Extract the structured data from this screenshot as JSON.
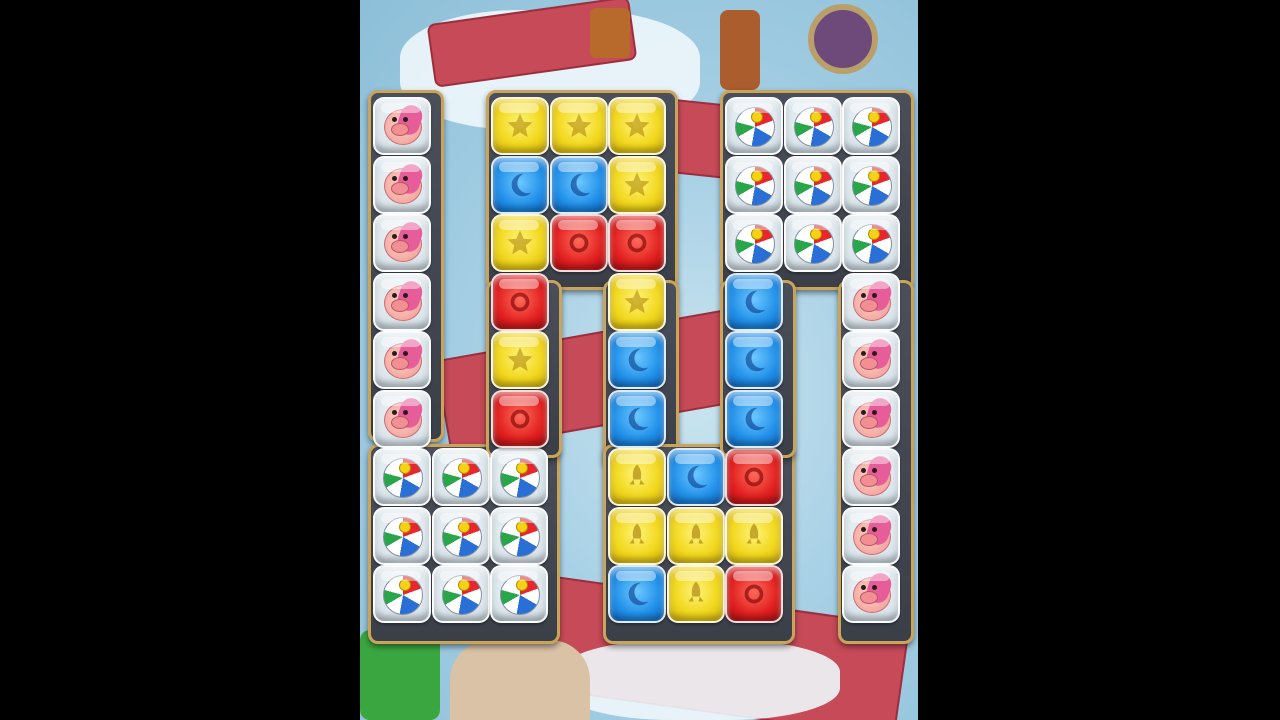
{
  "screen": {
    "background": "#000000",
    "game_area_color": "#a9d1e6"
  },
  "tile_types": {
    "Y": {
      "name": "yellow-block",
      "color": "#f2d81e"
    },
    "B": {
      "name": "blue-block",
      "color": "#1f8ee8"
    },
    "R": {
      "name": "red-block",
      "color": "#e01e1e"
    },
    "P": {
      "name": "piggy-bank",
      "color": "#f2a39c"
    },
    "BB": {
      "name": "beach-ball",
      "color": "#ffffff"
    }
  },
  "boards": [
    {
      "name": "board-left",
      "tiles": [
        {
          "row": 0,
          "col": 0,
          "type": "P"
        },
        {
          "row": 1,
          "col": 0,
          "type": "P"
        },
        {
          "row": 2,
          "col": 0,
          "type": "P"
        },
        {
          "row": 3,
          "col": 0,
          "type": "P"
        },
        {
          "row": 4,
          "col": 0,
          "type": "P"
        },
        {
          "row": 5,
          "col": 0,
          "type": "P"
        },
        {
          "row": 6,
          "col": 0,
          "type": "BB"
        },
        {
          "row": 6,
          "col": 1,
          "type": "BB"
        },
        {
          "row": 6,
          "col": 2,
          "type": "BB"
        },
        {
          "row": 7,
          "col": 0,
          "type": "BB"
        },
        {
          "row": 7,
          "col": 1,
          "type": "BB"
        },
        {
          "row": 7,
          "col": 2,
          "type": "BB"
        },
        {
          "row": 8,
          "col": 0,
          "type": "BB"
        },
        {
          "row": 8,
          "col": 1,
          "type": "BB"
        },
        {
          "row": 8,
          "col": 2,
          "type": "BB"
        }
      ]
    },
    {
      "name": "board-middle",
      "tiles": [
        {
          "row": 0,
          "col": 0,
          "type": "Y",
          "icon": "star"
        },
        {
          "row": 0,
          "col": 1,
          "type": "Y",
          "icon": "star"
        },
        {
          "row": 0,
          "col": 2,
          "type": "Y",
          "icon": "star"
        },
        {
          "row": 1,
          "col": 0,
          "type": "B",
          "icon": "moon"
        },
        {
          "row": 1,
          "col": 1,
          "type": "B",
          "icon": "moon"
        },
        {
          "row": 1,
          "col": 2,
          "type": "Y",
          "icon": "star"
        },
        {
          "row": 2,
          "col": 0,
          "type": "Y",
          "icon": "star"
        },
        {
          "row": 2,
          "col": 1,
          "type": "R",
          "icon": "ring"
        },
        {
          "row": 2,
          "col": 2,
          "type": "R",
          "icon": "ring"
        },
        {
          "row": 3,
          "col": 0,
          "type": "R",
          "icon": "ring"
        },
        {
          "row": 3,
          "col": 2,
          "type": "Y",
          "icon": "star"
        },
        {
          "row": 4,
          "col": 0,
          "type": "Y",
          "icon": "star"
        },
        {
          "row": 4,
          "col": 2,
          "type": "B",
          "icon": "moon"
        },
        {
          "row": 5,
          "col": 0,
          "type": "R",
          "icon": "ring"
        },
        {
          "row": 5,
          "col": 2,
          "type": "B",
          "icon": "moon"
        },
        {
          "row": 6,
          "col": 2,
          "type": "Y",
          "icon": "rocket"
        },
        {
          "row": 6,
          "col": 3,
          "type": "B",
          "icon": "moon"
        },
        {
          "row": 6,
          "col": 4,
          "type": "R",
          "icon": "ring"
        },
        {
          "row": 7,
          "col": 2,
          "type": "Y",
          "icon": "rocket"
        },
        {
          "row": 7,
          "col": 3,
          "type": "Y",
          "icon": "rocket"
        },
        {
          "row": 7,
          "col": 4,
          "type": "Y",
          "icon": "rocket"
        },
        {
          "row": 8,
          "col": 2,
          "type": "B",
          "icon": "moon"
        },
        {
          "row": 8,
          "col": 3,
          "type": "Y",
          "icon": "rocket"
        },
        {
          "row": 8,
          "col": 4,
          "type": "R",
          "icon": "ring"
        }
      ]
    },
    {
      "name": "board-right",
      "tiles": [
        {
          "row": 0,
          "col": 0,
          "type": "BB"
        },
        {
          "row": 0,
          "col": 1,
          "type": "BB"
        },
        {
          "row": 0,
          "col": 2,
          "type": "BB"
        },
        {
          "row": 1,
          "col": 0,
          "type": "BB"
        },
        {
          "row": 1,
          "col": 1,
          "type": "BB"
        },
        {
          "row": 1,
          "col": 2,
          "type": "BB"
        },
        {
          "row": 2,
          "col": 0,
          "type": "BB"
        },
        {
          "row": 2,
          "col": 1,
          "type": "BB"
        },
        {
          "row": 2,
          "col": 2,
          "type": "BB"
        },
        {
          "row": 3,
          "col": 0,
          "type": "B",
          "icon": "moon"
        },
        {
          "row": 3,
          "col": 2,
          "type": "P"
        },
        {
          "row": 4,
          "col": 0,
          "type": "B",
          "icon": "moon"
        },
        {
          "row": 4,
          "col": 2,
          "type": "P"
        },
        {
          "row": 5,
          "col": 0,
          "type": "B",
          "icon": "moon"
        },
        {
          "row": 5,
          "col": 2,
          "type": "P"
        },
        {
          "row": 6,
          "col": 2,
          "type": "P"
        },
        {
          "row": 7,
          "col": 2,
          "type": "P"
        },
        {
          "row": 8,
          "col": 2,
          "type": "P"
        }
      ]
    }
  ]
}
